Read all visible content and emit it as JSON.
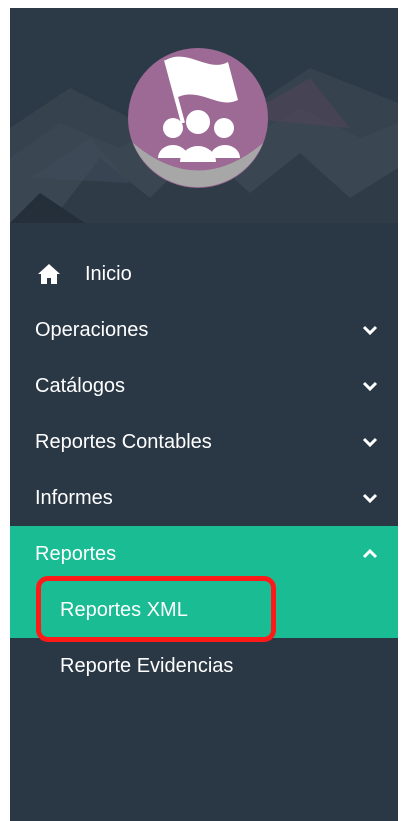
{
  "colors": {
    "sidebar_bg": "#2a3846",
    "active_bg": "#1abc94",
    "highlight_border": "#ff1a1a",
    "logo_bg": "#9c6a94"
  },
  "header": {
    "logo_icon": "team-flag-icon"
  },
  "menu": {
    "items": [
      {
        "label": "Inicio",
        "icon": "home-icon"
      },
      {
        "label": "Operaciones",
        "icon": "chevron-down-icon"
      },
      {
        "label": "Catálogos",
        "icon": "chevron-down-icon"
      },
      {
        "label": "Reportes Contables",
        "icon": "chevron-down-icon"
      },
      {
        "label": "Informes",
        "icon": "chevron-down-icon"
      },
      {
        "label": "Reportes",
        "icon": "chevron-up-icon"
      }
    ],
    "reportes_submenu": [
      {
        "label": "Reportes XML"
      },
      {
        "label": "Reporte Evidencias"
      }
    ]
  }
}
